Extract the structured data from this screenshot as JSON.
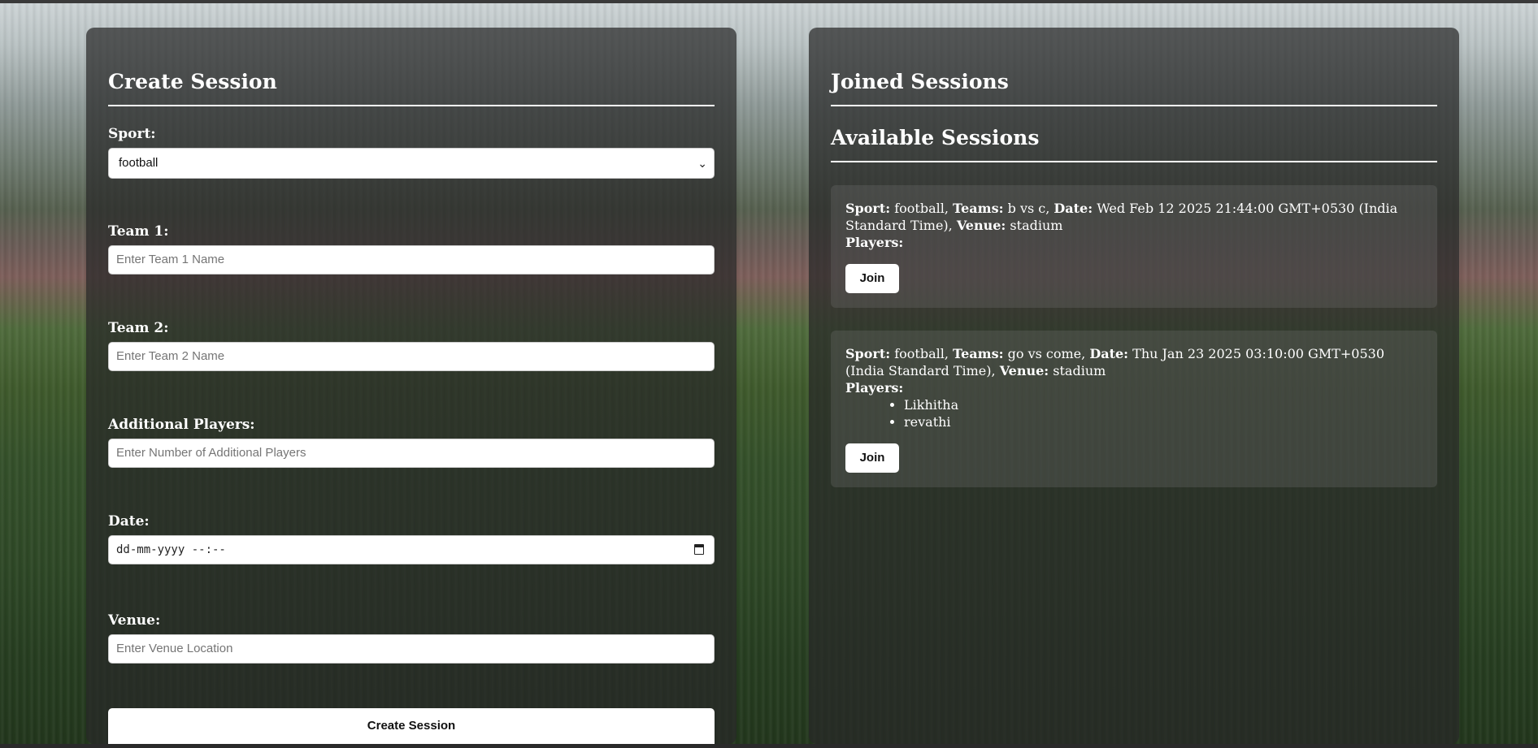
{
  "create_session": {
    "title": "Create Session",
    "sport_label": "Sport:",
    "sport_value": "football",
    "team1_label": "Team 1:",
    "team1_placeholder": "Enter Team 1 Name",
    "team2_label": "Team 2:",
    "team2_placeholder": "Enter Team 2 Name",
    "players_label": "Additional Players:",
    "players_placeholder": "Enter Number of Additional Players",
    "date_label": "Date:",
    "date_placeholder": "dd-mm-yyyy --:--",
    "venue_label": "Venue:",
    "venue_placeholder": "Enter Venue Location",
    "submit_label": "Create Session"
  },
  "joined_sessions": {
    "title": "Joined Sessions"
  },
  "available_sessions": {
    "title": "Available Sessions",
    "labels": {
      "sport": "Sport:",
      "teams": "Teams:",
      "date": "Date:",
      "venue": "Venue:",
      "players": "Players:"
    },
    "join_label": "Join",
    "sessions": [
      {
        "sport": "football,",
        "teams": "b vs c,",
        "date": "Wed Feb 12 2025 21:44:00 GMT+0530 (India Standard Time),",
        "venue": "stadium",
        "players": []
      },
      {
        "sport": "football,",
        "teams": "go vs come,",
        "date": "Thu Jan 23 2025 03:10:00 GMT+0530 (India Standard Time),",
        "venue": "stadium",
        "players": [
          "Likhitha",
          "revathi"
        ]
      }
    ]
  },
  "icons": {
    "select_chevron": "chevron-down-icon",
    "date_picker": "calendar-icon"
  }
}
